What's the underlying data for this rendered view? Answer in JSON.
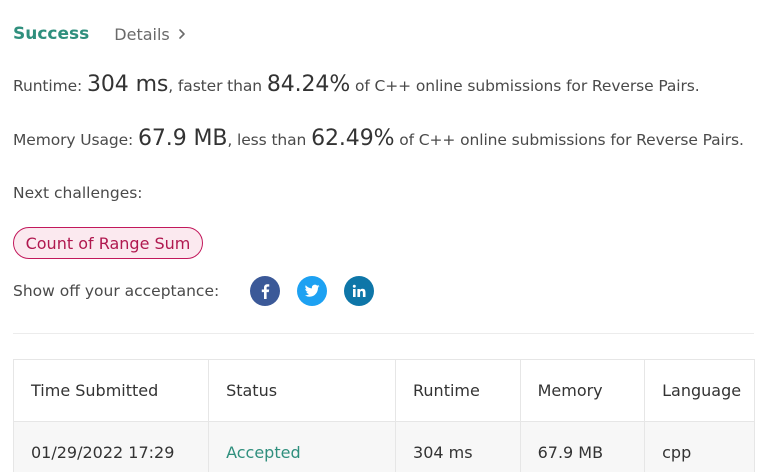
{
  "header": {
    "status": "Success",
    "details_label": "Details"
  },
  "runtime": {
    "label": "Runtime: ",
    "value": "304 ms",
    "mid": ", faster than ",
    "percent": "84.24%",
    "suffix": " of C++ online submissions for Reverse Pairs."
  },
  "memory": {
    "label": "Memory Usage: ",
    "value": "67.9 MB",
    "mid": ", less than ",
    "percent": "62.49%",
    "suffix": " of C++ online submissions for Reverse Pairs."
  },
  "next": {
    "label": "Next challenges:",
    "challenges": [
      "Count of Range Sum"
    ]
  },
  "share": {
    "label": "Show off your acceptance:",
    "icons": [
      "facebook-icon",
      "twitter-icon",
      "linkedin-icon"
    ]
  },
  "colors": {
    "success": "#2f8f7d",
    "pill_border": "#c2185b",
    "pill_bg": "#fbe9ef",
    "facebook": "#3b5998",
    "twitter": "#1da1f2",
    "linkedin": "#0e76a8"
  },
  "table": {
    "headers": [
      "Time Submitted",
      "Status",
      "Runtime",
      "Memory",
      "Language"
    ],
    "rows": [
      [
        "01/29/2022 17:29",
        "Accepted",
        "304 ms",
        "67.9 MB",
        "cpp"
      ]
    ]
  }
}
